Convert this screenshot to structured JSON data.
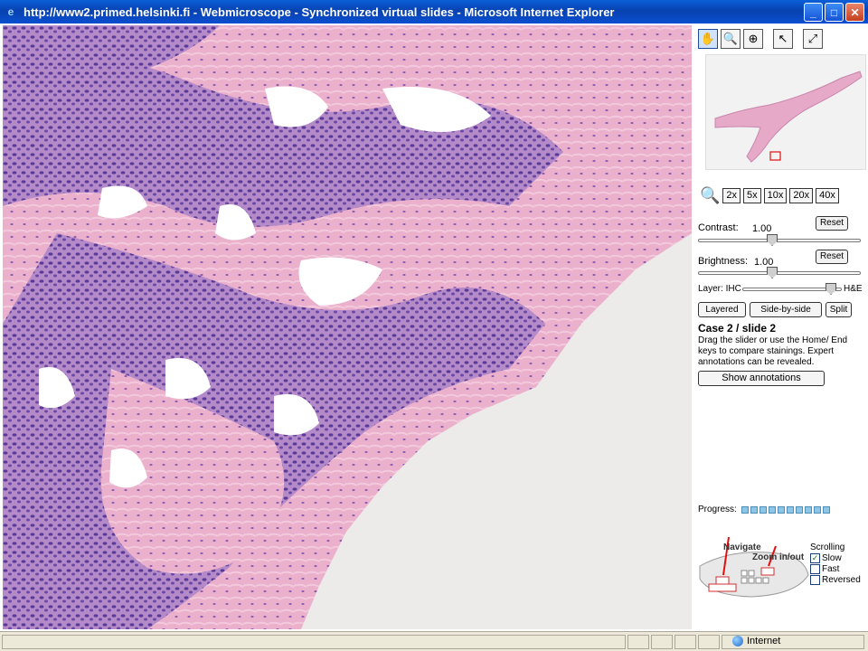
{
  "window": {
    "title": "http://www2.primed.helsinki.fi - Webmicroscope - Synchronized virtual slides - Microsoft Internet Explorer",
    "controls": [
      "minimize",
      "maximize",
      "close"
    ]
  },
  "toolbar": {
    "tools": [
      {
        "name": "pan-tool",
        "icon": "hand-icon"
      },
      {
        "name": "zoom-tool",
        "icon": "magnifier-icon"
      },
      {
        "name": "zoom-region-tool",
        "icon": "zoom-region-icon"
      },
      {
        "name": "annotate-tool",
        "icon": "pointer-plus-icon"
      },
      {
        "name": "fullscreen-tool",
        "icon": "fullscreen-icon"
      }
    ]
  },
  "zoom": {
    "levels": [
      "2x",
      "5x",
      "10x",
      "20x",
      "40x"
    ]
  },
  "adjustments": {
    "contrast_label": "Contrast:",
    "contrast_value": "1.00",
    "brightness_label": "Brightness:",
    "brightness_value": "1.00",
    "reset_label": "Reset",
    "layer_label": "Layer: IHC",
    "layer_right_label": "H&E",
    "contrast_level": 0.45,
    "brightness_level": 0.45,
    "layer_level": 0.95
  },
  "modes": {
    "layered": "Layered",
    "side_by_side": "Side-by-side",
    "split": "Split"
  },
  "case": {
    "title": "Case 2 / slide 2",
    "description": "Drag the slider or use the Home/ End keys to compare stainings. Expert annotations can be revealed.",
    "show_annotations": "Show annotations"
  },
  "progress": {
    "label": "Progress:",
    "cells": 10
  },
  "keyboard_help": {
    "navigate": "Navigate",
    "zoom": "Zoom in/out"
  },
  "scrolling": {
    "title": "Scrolling",
    "options": [
      {
        "label": "Slow",
        "checked": true
      },
      {
        "label": "Fast",
        "checked": false
      },
      {
        "label": "Reversed",
        "checked": false
      }
    ]
  },
  "status": {
    "zone": "Internet"
  },
  "colors": {
    "tissue_purple": "#6a4aa8",
    "tissue_pink": "#e8a6c6",
    "background": "#ecebe9",
    "progress": "#8ec6e6"
  }
}
